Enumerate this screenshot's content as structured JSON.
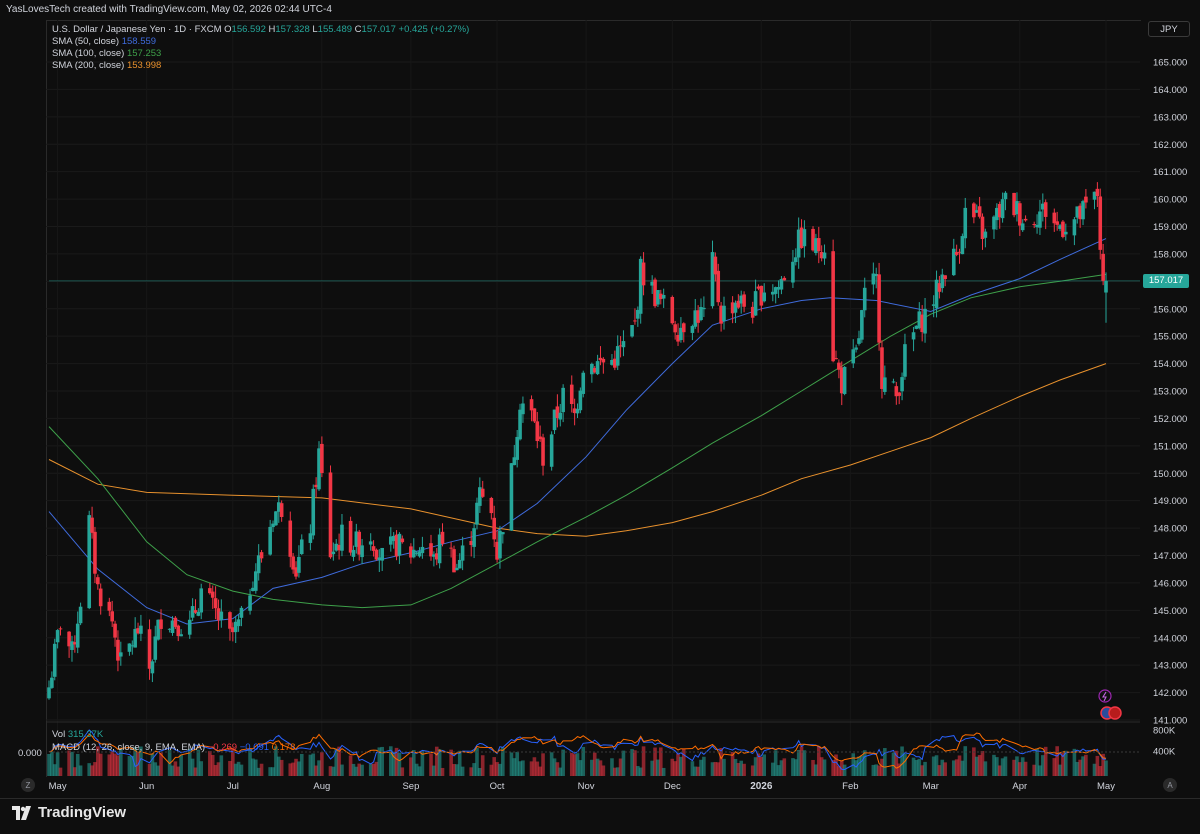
{
  "caption": "YasLovesTech created with TradingView.com, May 02, 2026 02:44 UTC-4",
  "legend": {
    "symbol": "U.S. Dollar / Japanese Yen · 1D · FXCM",
    "o_label": "O",
    "o": "156.592",
    "h_label": "H",
    "h": "157.328",
    "l_label": "L",
    "l": "155.489",
    "c_label": "C",
    "c": "157.017",
    "change": "+0.425 (+0.27%)",
    "sma50_label": "SMA (50, close)",
    "sma50_value": "158.559",
    "sma100_label": "SMA (100, close)",
    "sma100_value": "157.253",
    "sma200_label": "SMA (200, close)",
    "sma200_value": "153.998"
  },
  "bottom_legend": {
    "vol_label": "Vol",
    "vol_value": "315.37K",
    "macd_label": "MACD (12, 26, close, 9, EMA, EMA)",
    "macd_hist": "−0.269",
    "macd_line": "−0.091",
    "macd_signal": "0.178"
  },
  "currency_button": "JPY",
  "last_price": "157.017",
  "vol_zero_label": "0.000",
  "brand": "TradingView",
  "zoom_button": "Z",
  "auto_button": "A",
  "colors": {
    "up": "#26a69a",
    "down": "#f23645",
    "sma50": "#3f6bdc",
    "sma100": "#3ea04a",
    "sma200": "#e8912d",
    "macd_line": "#2962ff",
    "macd_signal": "#ff6d00"
  },
  "chart_data": {
    "type": "candlestick",
    "symbol": "USD/JPY",
    "interval": "1D",
    "y_axis": {
      "ticks": [
        "141.000",
        "142.000",
        "143.000",
        "144.000",
        "145.000",
        "146.000",
        "147.000",
        "148.000",
        "149.000",
        "150.000",
        "151.000",
        "152.000",
        "153.000",
        "154.000",
        "155.000",
        "156.000",
        "157.000",
        "158.000",
        "159.000",
        "160.000",
        "161.000",
        "162.000",
        "163.000",
        "164.000",
        "165.000"
      ],
      "range": [
        141.0,
        166.0
      ]
    },
    "x_axis": {
      "ticks": [
        "May",
        "Jun",
        "Jul",
        "Aug",
        "Sep",
        "Oct",
        "Nov",
        "Dec",
        "2026",
        "Feb",
        "Mar",
        "Apr",
        "May"
      ],
      "bold_tick": "2026"
    },
    "close_path": [
      [
        "2025-04-28",
        142.2
      ],
      [
        "2025-05-02",
        144.6
      ],
      [
        "2025-05-06",
        143.4
      ],
      [
        "2025-05-09",
        145.4
      ],
      [
        "2025-05-12",
        148.2
      ],
      [
        "2025-05-15",
        145.8
      ],
      [
        "2025-05-20",
        144.6
      ],
      [
        "2025-05-23",
        143.0
      ],
      [
        "2025-05-29",
        144.3
      ],
      [
        "2025-06-02",
        142.9
      ],
      [
        "2025-06-06",
        144.8
      ],
      [
        "2025-06-11",
        144.6
      ],
      [
        "2025-06-16",
        144.4
      ],
      [
        "2025-06-20",
        145.7
      ],
      [
        "2025-06-25",
        144.9
      ],
      [
        "2025-06-30",
        144.0
      ],
      [
        "2025-07-04",
        144.6
      ],
      [
        "2025-07-08",
        146.3
      ],
      [
        "2025-07-11",
        147.0
      ],
      [
        "2025-07-15",
        148.5
      ],
      [
        "2025-07-18",
        148.8
      ],
      [
        "2025-07-23",
        146.5
      ],
      [
        "2025-07-28",
        148.1
      ],
      [
        "2025-07-31",
        150.7
      ],
      [
        "2025-08-04",
        147.1
      ],
      [
        "2025-08-08",
        147.7
      ],
      [
        "2025-08-13",
        147.4
      ],
      [
        "2025-08-18",
        147.8
      ],
      [
        "2025-08-22",
        146.9
      ],
      [
        "2025-08-27",
        147.4
      ],
      [
        "2025-09-01",
        147.1
      ],
      [
        "2025-09-05",
        147.4
      ],
      [
        "2025-09-09",
        146.8
      ],
      [
        "2025-09-12",
        147.7
      ],
      [
        "2025-09-17",
        146.6
      ],
      [
        "2025-09-22",
        147.8
      ],
      [
        "2025-09-25",
        149.2
      ],
      [
        "2025-09-29",
        148.6
      ],
      [
        "2025-10-01",
        147.1
      ],
      [
        "2025-10-06",
        150.0
      ],
      [
        "2025-10-09",
        152.7
      ],
      [
        "2025-10-13",
        152.1
      ],
      [
        "2025-10-17",
        150.6
      ],
      [
        "2025-10-21",
        151.9
      ],
      [
        "2025-10-24",
        152.8
      ],
      [
        "2025-10-28",
        152.1
      ],
      [
        "2025-10-31",
        154.0
      ],
      [
        "2025-11-05",
        154.0
      ],
      [
        "2025-11-10",
        154.1
      ],
      [
        "2025-11-14",
        154.6
      ],
      [
        "2025-11-18",
        155.4
      ],
      [
        "2025-11-20",
        157.4
      ],
      [
        "2025-11-25",
        156.5
      ],
      [
        "2025-11-28",
        156.1
      ],
      [
        "2025-12-03",
        155.3
      ],
      [
        "2025-12-08",
        155.8
      ],
      [
        "2025-12-12",
        155.8
      ],
      [
        "2025-12-15",
        157.6
      ],
      [
        "2025-12-18",
        155.8
      ],
      [
        "2025-12-23",
        156.3
      ],
      [
        "2025-12-29",
        156.0
      ],
      [
        "2026-01-02",
        156.8
      ],
      [
        "2026-01-07",
        156.8
      ],
      [
        "2026-01-12",
        158.0
      ],
      [
        "2026-01-15",
        158.6
      ],
      [
        "2026-01-20",
        158.2
      ],
      [
        "2026-01-23",
        158.4
      ],
      [
        "2026-01-26",
        154.4
      ],
      [
        "2026-01-29",
        153.3
      ],
      [
        "2026-02-03",
        154.3
      ],
      [
        "2026-02-06",
        156.4
      ],
      [
        "2026-02-10",
        157.0
      ],
      [
        "2026-02-12",
        153.5
      ],
      [
        "2026-02-17",
        152.8
      ],
      [
        "2026-02-20",
        154.3
      ],
      [
        "2026-02-24",
        155.3
      ],
      [
        "2026-02-27",
        155.8
      ],
      [
        "2026-03-03",
        156.6
      ],
      [
        "2026-03-06",
        157.5
      ],
      [
        "2026-03-10",
        158.0
      ],
      [
        "2026-03-13",
        159.5
      ],
      [
        "2026-03-17",
        159.2
      ],
      [
        "2026-03-20",
        158.6
      ],
      [
        "2026-03-24",
        159.4
      ],
      [
        "2026-03-27",
        159.9
      ],
      [
        "2026-03-31",
        159.6
      ],
      [
        "2026-04-03",
        159.2
      ],
      [
        "2026-04-07",
        159.5
      ],
      [
        "2026-04-10",
        159.6
      ],
      [
        "2026-04-14",
        159.0
      ],
      [
        "2026-04-17",
        159.1
      ],
      [
        "2026-04-21",
        159.3
      ],
      [
        "2026-04-24",
        159.6
      ],
      [
        "2026-04-28",
        160.2
      ],
      [
        "2026-04-30",
        156.6
      ],
      [
        "2026-05-01",
        157.0
      ]
    ],
    "last_candle": {
      "date": "2026-05-01",
      "open": 156.592,
      "high": 157.328,
      "low": 155.489,
      "close": 157.017
    },
    "sma50": [
      [
        "2025-04-28",
        148.6
      ],
      [
        "2025-05-15",
        146.5
      ],
      [
        "2025-06-01",
        145.1
      ],
      [
        "2025-06-15",
        144.5
      ],
      [
        "2025-07-01",
        144.7
      ],
      [
        "2025-07-15",
        145.8
      ],
      [
        "2025-08-01",
        146.2
      ],
      [
        "2025-08-15",
        146.7
      ],
      [
        "2025-09-01",
        147.1
      ],
      [
        "2025-09-15",
        147.5
      ],
      [
        "2025-10-01",
        147.9
      ],
      [
        "2025-10-15",
        148.9
      ],
      [
        "2025-11-01",
        150.6
      ],
      [
        "2025-11-15",
        152.3
      ],
      [
        "2025-12-01",
        154.0
      ],
      [
        "2025-12-15",
        155.4
      ],
      [
        "2026-01-01",
        156.0
      ],
      [
        "2026-01-15",
        156.3
      ],
      [
        "2026-01-25",
        156.4
      ],
      [
        "2026-02-10",
        156.3
      ],
      [
        "2026-03-01",
        155.9
      ],
      [
        "2026-03-15",
        156.5
      ],
      [
        "2026-04-01",
        157.1
      ],
      [
        "2026-04-15",
        157.8
      ],
      [
        "2026-05-01",
        158.559
      ]
    ],
    "sma100": [
      [
        "2025-04-28",
        151.7
      ],
      [
        "2025-05-15",
        149.8
      ],
      [
        "2025-06-01",
        147.5
      ],
      [
        "2025-06-15",
        146.3
      ],
      [
        "2025-07-01",
        145.7
      ],
      [
        "2025-07-15",
        145.4
      ],
      [
        "2025-08-01",
        145.2
      ],
      [
        "2025-08-15",
        145.1
      ],
      [
        "2025-09-01",
        145.2
      ],
      [
        "2025-09-15",
        145.8
      ],
      [
        "2025-10-01",
        146.7
      ],
      [
        "2025-10-15",
        147.5
      ],
      [
        "2025-11-01",
        148.4
      ],
      [
        "2025-11-15",
        149.2
      ],
      [
        "2025-12-01",
        150.2
      ],
      [
        "2025-12-15",
        151.1
      ],
      [
        "2026-01-01",
        152.1
      ],
      [
        "2026-01-15",
        153.0
      ],
      [
        "2026-02-01",
        154.1
      ],
      [
        "2026-02-15",
        155.0
      ],
      [
        "2026-03-01",
        155.8
      ],
      [
        "2026-03-15",
        156.4
      ],
      [
        "2026-04-01",
        156.8
      ],
      [
        "2026-04-15",
        157.0
      ],
      [
        "2026-05-01",
        157.253
      ]
    ],
    "sma200": [
      [
        "2025-04-28",
        150.5
      ],
      [
        "2025-05-15",
        149.6
      ],
      [
        "2025-06-01",
        149.3
      ],
      [
        "2025-07-01",
        149.2
      ],
      [
        "2025-08-01",
        149.1
      ],
      [
        "2025-09-01",
        148.7
      ],
      [
        "2025-10-01",
        148.0
      ],
      [
        "2025-10-15",
        147.8
      ],
      [
        "2025-11-01",
        147.7
      ],
      [
        "2025-11-15",
        147.9
      ],
      [
        "2025-12-01",
        148.2
      ],
      [
        "2025-12-15",
        148.6
      ],
      [
        "2026-01-01",
        149.2
      ],
      [
        "2026-01-15",
        149.8
      ],
      [
        "2026-02-01",
        150.3
      ],
      [
        "2026-02-15",
        150.8
      ],
      [
        "2026-03-01",
        151.3
      ],
      [
        "2026-03-15",
        152.0
      ],
      [
        "2026-04-01",
        152.8
      ],
      [
        "2026-04-15",
        153.4
      ],
      [
        "2026-05-01",
        153.998
      ]
    ],
    "volume_axis_ticks": [
      "800K",
      "400K"
    ]
  }
}
